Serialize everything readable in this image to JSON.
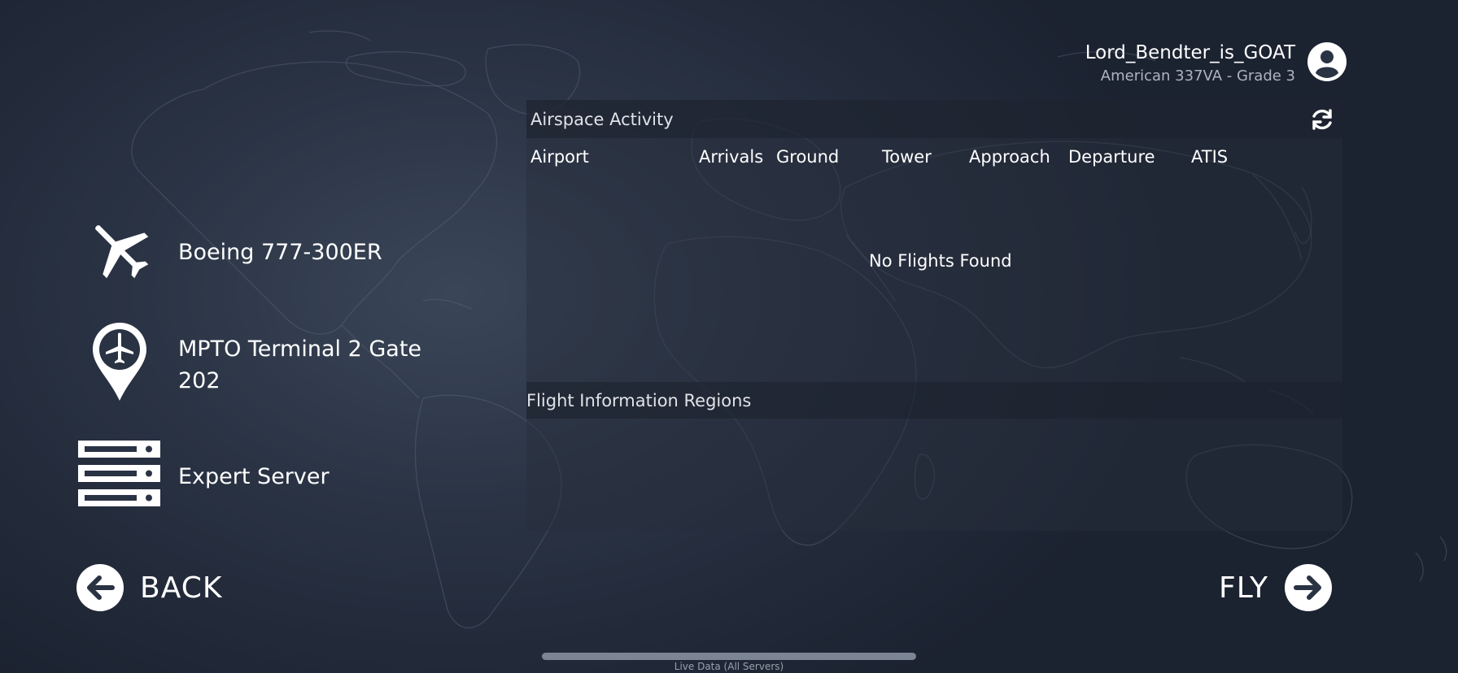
{
  "user": {
    "name": "Lord_Bendter_is_GOAT",
    "subtitle": "American 337VA - Grade 3",
    "avatar_icon": "user-circle-icon"
  },
  "flight_info": {
    "aircraft": {
      "icon": "airplane-icon",
      "label": "Boeing 777-300ER"
    },
    "location": {
      "icon": "airport-pin-icon",
      "line1": "MPTO Terminal 2 Gate",
      "line2": "202"
    },
    "server": {
      "icon": "server-icon",
      "label": "Expert Server"
    }
  },
  "airspace": {
    "title": "Airspace Activity",
    "refresh_icon": "refresh-icon",
    "columns": [
      "Airport",
      "Arrivals",
      "Ground",
      "Tower",
      "Approach",
      "Departure",
      "ATIS"
    ],
    "empty_message": "No Flights Found"
  },
  "fir": {
    "title": "Flight Information Regions"
  },
  "buttons": {
    "back": {
      "label": "BACK",
      "icon": "arrow-left-icon"
    },
    "fly": {
      "label": "FLY",
      "icon": "arrow-right-icon"
    }
  },
  "footer": {
    "live_data": "Live Data (All Servers)"
  },
  "colors": {
    "background_dark": "#1b2230",
    "background_light": "#3a4658",
    "text": "#ffffff",
    "subtext": "#aeb4bf"
  }
}
